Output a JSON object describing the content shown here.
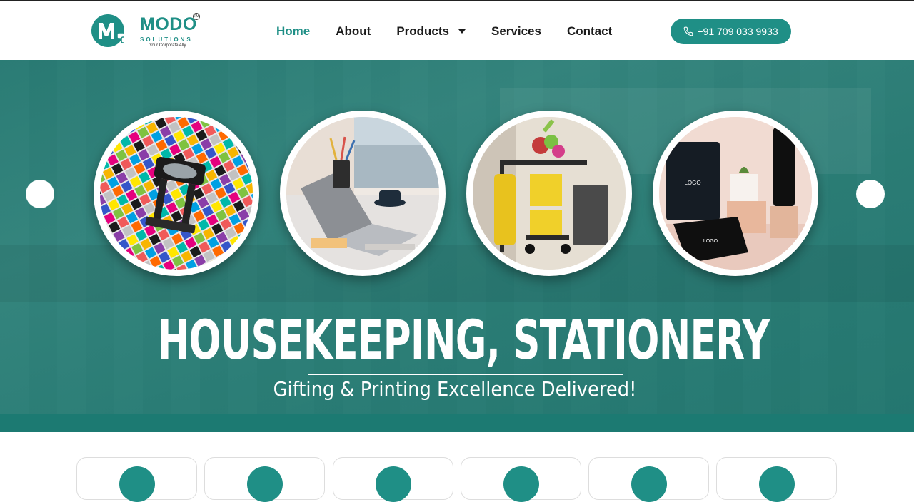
{
  "brand": {
    "name": "MODO",
    "mark": "MoDo",
    "trademark": "TM",
    "subtitle": "SOLUTIONS",
    "tagline": "Your Corporate Ally",
    "accent_color": "#1f8f86"
  },
  "nav": {
    "items": [
      {
        "label": "Home",
        "active": true
      },
      {
        "label": "About",
        "active": false
      },
      {
        "label": "Products",
        "active": false,
        "has_dropdown": true
      },
      {
        "label": "Services",
        "active": false
      },
      {
        "label": "Contact",
        "active": false
      }
    ]
  },
  "contact": {
    "phone_label": "+91 709 033 9933",
    "icon": "phone-icon"
  },
  "hero": {
    "title": "HOUSEKEEPING, STATIONERY",
    "subtitle": "Gifting & Printing Excellence Delivered!",
    "overlay_color": "#1c7a72",
    "images": [
      {
        "name": "color-printing-swatches-image"
      },
      {
        "name": "laptop-stationery-desk-image"
      },
      {
        "name": "housekeeping-cart-image"
      },
      {
        "name": "branded-corporate-gifts-image"
      }
    ]
  },
  "feature_cards": [
    {
      "icon": "feature-icon-1"
    },
    {
      "icon": "feature-icon-2"
    },
    {
      "icon": "feature-icon-3"
    },
    {
      "icon": "feature-icon-4"
    },
    {
      "icon": "feature-icon-5"
    },
    {
      "icon": "feature-icon-6"
    }
  ]
}
